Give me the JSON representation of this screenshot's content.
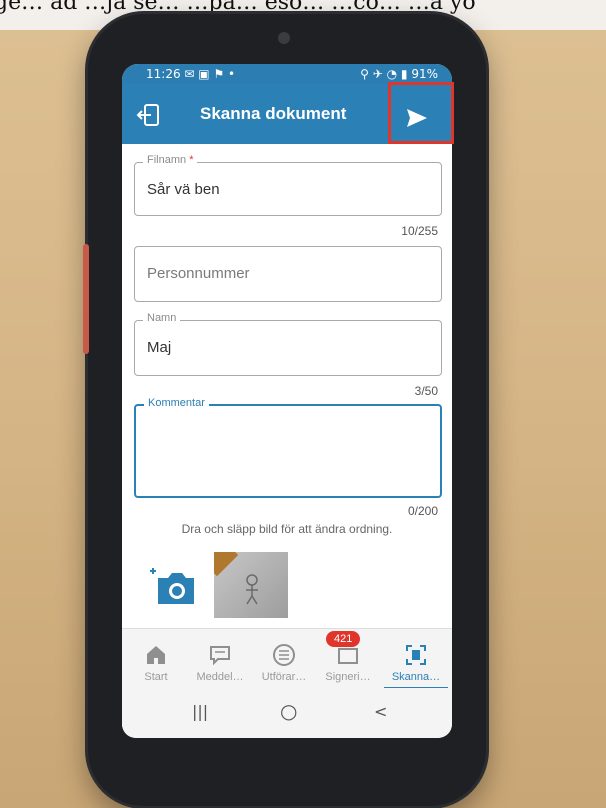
{
  "photo_overlay_text": "ge… ad …ja se… …pa… eso… …co… …a yo",
  "status_bar": {
    "time": "11:26",
    "notifications": "✉ ▣ ⚑ •",
    "battery": "91%"
  },
  "app_bar": {
    "title": "Skanna dokument",
    "back_icon": "exit-icon",
    "send_icon": "send-icon"
  },
  "form": {
    "filnamn": {
      "label": "Filnamn",
      "required_mark": "*",
      "value": "Sår vä ben",
      "counter": "10/255"
    },
    "personnummer": {
      "placeholder": "Personnummer"
    },
    "namn": {
      "label": "Namn",
      "value": "Maj",
      "counter": "3/50"
    },
    "kommentar": {
      "label": "Kommentar",
      "value": "",
      "counter": "0/200"
    }
  },
  "hint": "Dra och släpp bild för att ändra ordning.",
  "bottom_nav": [
    {
      "label": "Start",
      "icon": "home-icon"
    },
    {
      "label": "Meddel…",
      "icon": "message-icon"
    },
    {
      "label": "Utförar…",
      "icon": "list-icon"
    },
    {
      "label": "Signeri…",
      "icon": "sign-icon",
      "badge": "421"
    },
    {
      "label": "Skanna…",
      "icon": "scan-icon",
      "active": true
    }
  ],
  "system_nav": {
    "recents": "|||",
    "home": "○",
    "back": "<"
  },
  "colors": {
    "primary": "#2b80b5",
    "highlight": "#e0352b"
  }
}
